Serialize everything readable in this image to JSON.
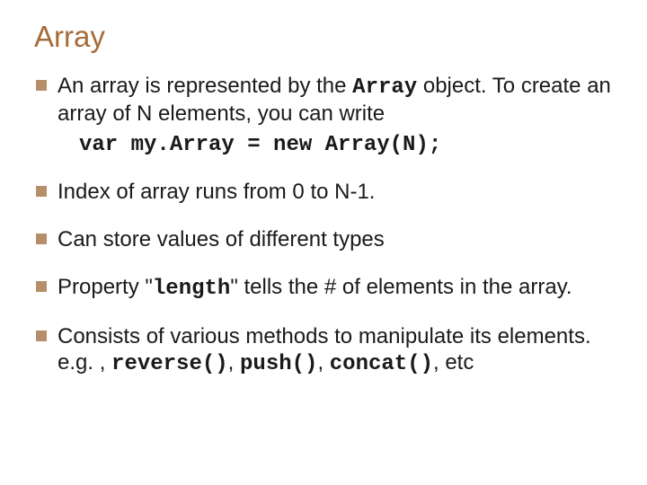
{
  "title": "Array",
  "bullets": {
    "b1": {
      "pre": "An array is represented by the ",
      "code": "Array",
      "post": " object. To create an array of N elements, you can write",
      "sub": "var my.Array = new Array(N);"
    },
    "b2": "Index of array runs from 0 to N-1.",
    "b3": "Can store values of different types",
    "b4": {
      "pre": "Property \"",
      "code": "length",
      "post": "\" tells the # of elements in the array."
    },
    "b5": {
      "pre": "Consists of various methods to manipulate its elements. e.g. , ",
      "c1": "reverse()",
      "sep1": ", ",
      "c2": "push()",
      "sep2": ", ",
      "c3": "concat()",
      "post": ", etc"
    }
  }
}
